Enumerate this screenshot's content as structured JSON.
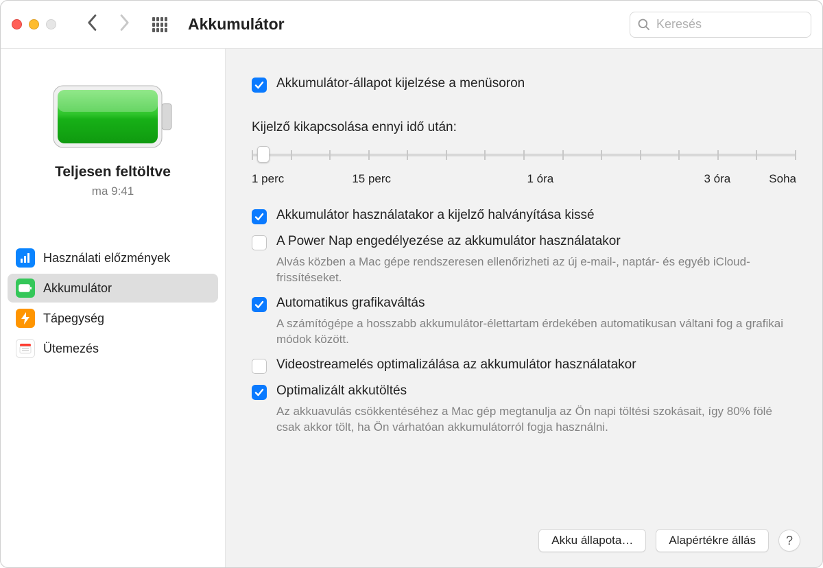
{
  "window": {
    "title": "Akkumulátor",
    "search_placeholder": "Keresés"
  },
  "sidebar": {
    "status": "Teljesen feltöltve",
    "time": "ma 9:41",
    "items": [
      {
        "label": "Használati előzmények",
        "icon": "chart-icon",
        "color": "blue"
      },
      {
        "label": "Akkumulátor",
        "icon": "battery-icon",
        "color": "green",
        "selected": true
      },
      {
        "label": "Tápegység",
        "icon": "bolt-icon",
        "color": "orange"
      },
      {
        "label": "Ütemezés",
        "icon": "calendar-icon",
        "color": "white"
      }
    ]
  },
  "options": {
    "show_in_menubar": {
      "label": "Akkumulátor-állapot kijelzése a menüsoron",
      "checked": true
    },
    "slider_title": "Kijelző kikapcsolása ennyi idő után:",
    "slider_labels": [
      "1 perc",
      "15 perc",
      "1 óra",
      "3 óra",
      "Soha"
    ],
    "dim_on_battery": {
      "label": "Akkumulátor használatakor a kijelző halványítása kissé",
      "checked": true
    },
    "power_nap": {
      "label": "A Power Nap engedélyezése az akkumulátor használatakor",
      "checked": false,
      "desc": "Alvás közben a Mac gépe rendszeresen ellenőrizheti az új e-mail-, naptár- és egyéb iCloud-frissítéseket."
    },
    "auto_graphics": {
      "label": "Automatikus grafikaváltás",
      "checked": true,
      "desc": "A számítógépe a hosszabb akkumulátor-élettartam érdekében automatikusan váltani fog a grafikai módok között."
    },
    "video_stream_opt": {
      "label": "Videostreamelés optimalizálása az akkumulátor használatakor",
      "checked": false
    },
    "optimized_charging": {
      "label": "Optimalizált akkutöltés",
      "checked": true,
      "desc": "Az akkuavulás csökkentéséhez a Mac gép megtanulja az Ön napi töltési szokásait, így 80% fölé csak akkor tölt, ha Ön várhatóan akkumulátorról fogja használni."
    }
  },
  "buttons": {
    "battery_health": "Akku állapota…",
    "restore_defaults": "Alapértékre állás",
    "help": "?"
  }
}
